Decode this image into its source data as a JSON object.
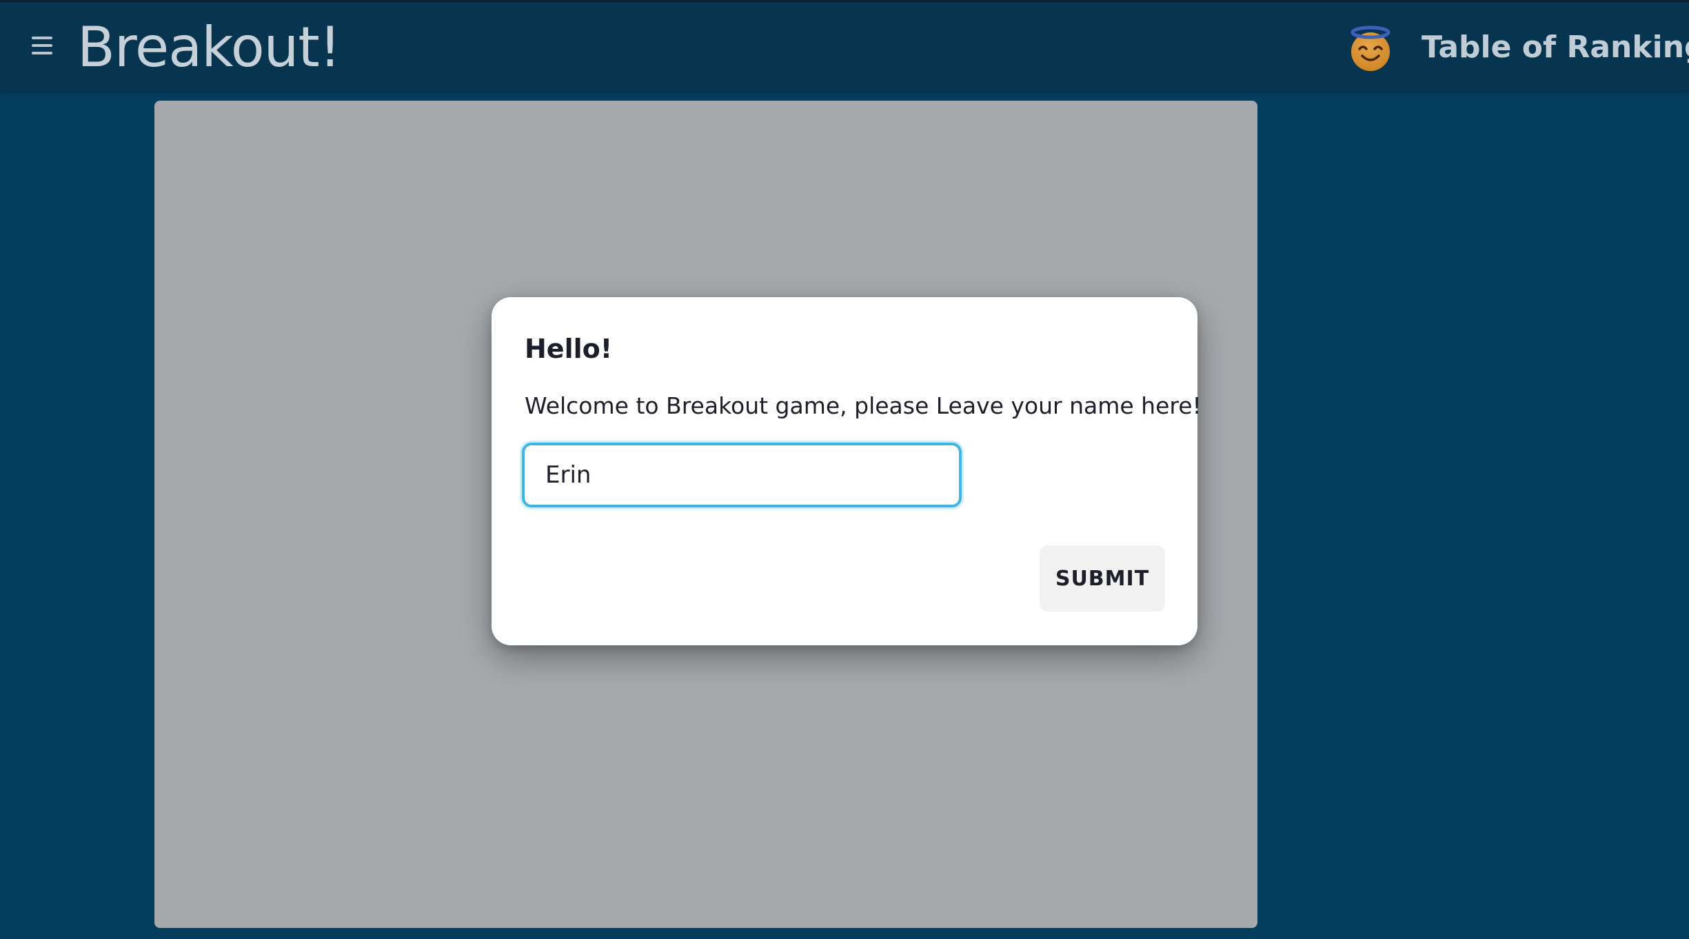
{
  "header": {
    "title": "Breakout!",
    "menu_icon": "hamburger-menu-icon",
    "avatar_icon": "smiling-face-with-halo-icon",
    "ranking_link": "Table of Ranking"
  },
  "dialog": {
    "title": "Hello!",
    "message": "Welcome to Breakout game, please Leave your name here!",
    "name_input_value": "Erin",
    "submit_label": "SUBMIT"
  },
  "colors": {
    "page_background": "#053d5e",
    "header_background": "#07354f",
    "canvas_background": "#a6aaad",
    "input_focus": "#3fb4e4"
  }
}
